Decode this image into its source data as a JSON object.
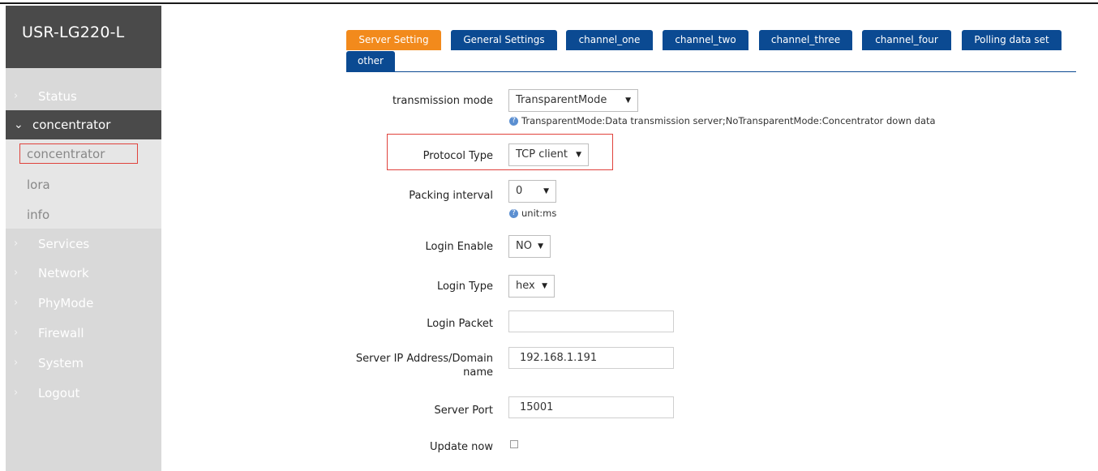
{
  "brand": {
    "title": "USR-LG220-L"
  },
  "sidebar": {
    "items": [
      {
        "label": "Status",
        "chev": "›"
      },
      {
        "label": "concentrator",
        "chev": "⌄"
      },
      {
        "label": "Services",
        "chev": "›"
      },
      {
        "label": "Network",
        "chev": "›"
      },
      {
        "label": "PhyMode",
        "chev": "›"
      },
      {
        "label": "Firewall",
        "chev": "›"
      },
      {
        "label": "System",
        "chev": "›"
      },
      {
        "label": "Logout",
        "chev": "›"
      }
    ],
    "submenu": [
      {
        "label": "concentrator"
      },
      {
        "label": "lora"
      },
      {
        "label": "info"
      }
    ]
  },
  "tabs": [
    {
      "label": "Server Setting",
      "active": true
    },
    {
      "label": "General Settings"
    },
    {
      "label": "channel_one"
    },
    {
      "label": "channel_two"
    },
    {
      "label": "channel_three"
    },
    {
      "label": "channel_four"
    },
    {
      "label": "Polling data set"
    },
    {
      "label": "other"
    }
  ],
  "form": {
    "transmission_mode": {
      "label": "transmission mode",
      "value": "TransparentMode",
      "hint": "TransparentMode:Data transmission server;NoTransparentMode:Concentrator down data"
    },
    "protocol_type": {
      "label": "Protocol Type",
      "value": "TCP client"
    },
    "packing_interval": {
      "label": "Packing interval",
      "value": "0",
      "hint": "unit:ms"
    },
    "login_enable": {
      "label": "Login Enable",
      "value": "NO"
    },
    "login_type": {
      "label": "Login Type",
      "value": "hex"
    },
    "login_packet": {
      "label": "Login Packet",
      "value": ""
    },
    "server_ip": {
      "label_line1": "Server IP Address/Domain",
      "label_line2": "name",
      "value": "192.168.1.191"
    },
    "server_port": {
      "label": "Server Port",
      "value": "15001"
    },
    "update_now": {
      "label": "Update now",
      "checked": false
    }
  },
  "icons": {
    "dropdown": "▼",
    "help": "?"
  },
  "colors": {
    "brand_bg": "#4a4a4a",
    "sidebar_bg": "#d9d9d9",
    "tab_blue": "#0b4a92",
    "tab_active_orange": "#f28a1c",
    "highlight_red": "#e0423c"
  }
}
